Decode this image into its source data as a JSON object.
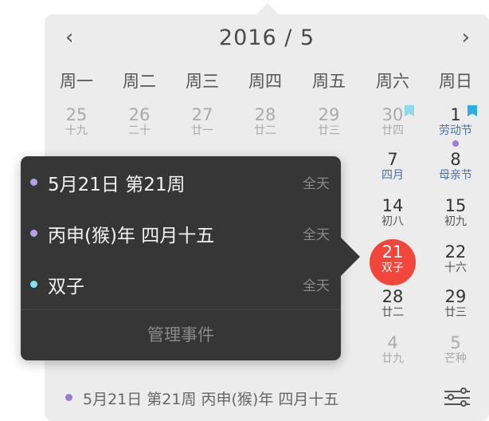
{
  "header": {
    "prev_icon": "‹",
    "next_icon": "›",
    "title": "2016 / 5"
  },
  "weekdays": [
    "周一",
    "周二",
    "周三",
    "周四",
    "周五",
    "周六",
    "周日"
  ],
  "days": {
    "apr25": {
      "num": "25",
      "sub": "十九"
    },
    "apr26": {
      "num": "26",
      "sub": "二十"
    },
    "apr27": {
      "num": "27",
      "sub": "廿一"
    },
    "apr28": {
      "num": "28",
      "sub": "廿二"
    },
    "apr29": {
      "num": "29",
      "sub": "廿三"
    },
    "apr30": {
      "num": "30",
      "sub": "廿四"
    },
    "may1": {
      "num": "1",
      "sub": "劳动节"
    },
    "may7": {
      "num": "7",
      "sub": "四月"
    },
    "may8": {
      "num": "8",
      "sub": "母亲节"
    },
    "may14": {
      "num": "14",
      "sub": "初八"
    },
    "may15": {
      "num": "15",
      "sub": "初九"
    },
    "may21": {
      "num": "21",
      "sub": "双子"
    },
    "may22": {
      "num": "22",
      "sub": "十六"
    },
    "may28": {
      "num": "28",
      "sub": "廿二"
    },
    "may29": {
      "num": "29",
      "sub": "廿三"
    },
    "jun4": {
      "num": "4",
      "sub": "廿九"
    },
    "jun5": {
      "num": "5",
      "sub": "芒种"
    }
  },
  "tooltip": {
    "events": [
      {
        "title": "5月21日 第21周",
        "allday": "全天",
        "color": "#b7a0e8"
      },
      {
        "title": "丙申(猴)年 四月十五",
        "allday": "全天",
        "color": "#b7a0e8"
      },
      {
        "title": "双子",
        "allday": "全天",
        "color": "#7fe3ee"
      }
    ],
    "manage_label": "管理事件"
  },
  "footer": {
    "text": "5月21日 第21周 丙申(猴)年 四月十五",
    "settings_icon": "sliders-icon"
  },
  "colors": {
    "today": "#f0463c",
    "event_dot": "#9a7bd6",
    "tooltip_bg": "#363636",
    "panel_bg": "#ececec"
  }
}
